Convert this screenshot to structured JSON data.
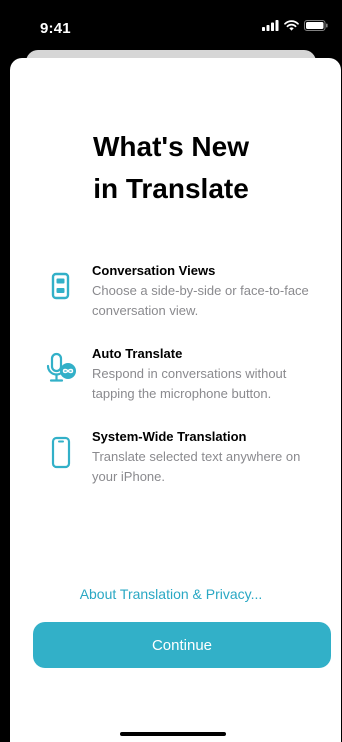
{
  "status_bar": {
    "time": "9:41",
    "icons": [
      "signal-icon",
      "wifi-icon",
      "battery-icon"
    ]
  },
  "title": {
    "line1": "What's New",
    "line2": "in Translate"
  },
  "features": [
    {
      "icon": "conversation-views-icon",
      "title": "Conversation Views",
      "description": "Choose a side-by-side or face-to-face conversation view."
    },
    {
      "icon": "microphone-infinity-icon",
      "title": "Auto Translate",
      "description": "Respond in conversations without tapping the microphone button."
    },
    {
      "icon": "iphone-icon",
      "title": "System-Wide Translation",
      "description": "Translate selected text anywhere on your iPhone."
    }
  ],
  "about_link": "About Translation & Privacy...",
  "continue_button": "Continue",
  "colors": {
    "accent": "#32b0c8",
    "link": "#2aa8c4",
    "secondary_text": "#8a8a8e"
  }
}
